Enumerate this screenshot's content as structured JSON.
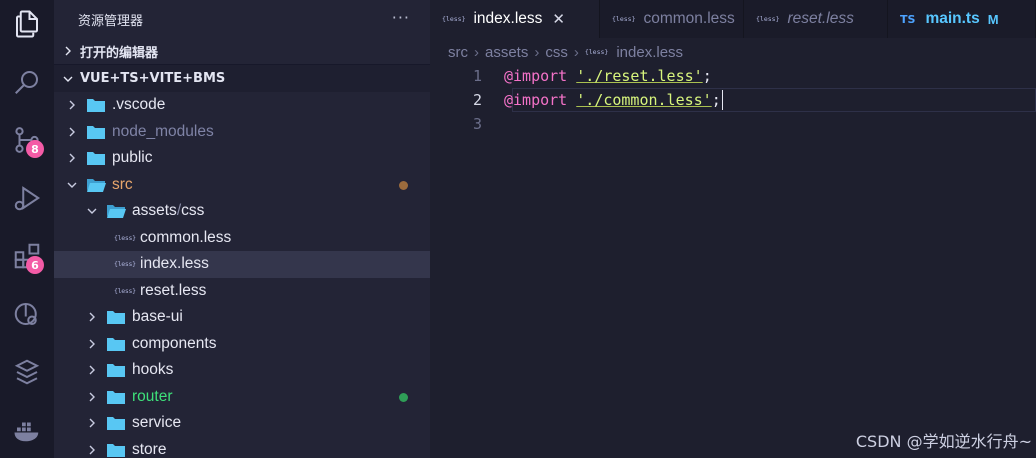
{
  "sidebar": {
    "title": "资源管理器",
    "more": "···",
    "open_editors": "打开的编辑器",
    "project": "VUE+TS+VITE+BMS",
    "tree": [
      {
        "label": ".vscode",
        "type": "folder",
        "depth": 1,
        "expanded": false,
        "color": "#e6e7f2"
      },
      {
        "label": "node_modules",
        "type": "folder",
        "depth": 1,
        "expanded": false,
        "color": "#7f83a6"
      },
      {
        "label": "public",
        "type": "folder",
        "depth": 1,
        "expanded": false,
        "color": "#e6e7f2"
      },
      {
        "label": "src",
        "type": "folder",
        "depth": 1,
        "expanded": true,
        "color": "#e8a66b",
        "dot": "#9b6b3d"
      },
      {
        "label": "assets",
        "label2": "css",
        "type": "folder",
        "depth": 2,
        "expanded": true,
        "color": "#e6e7f2"
      },
      {
        "label": "common.less",
        "type": "less",
        "depth": 3,
        "color": "#e6e7f2"
      },
      {
        "label": "index.less",
        "type": "less",
        "depth": 3,
        "color": "#e6e7f2",
        "selected": true
      },
      {
        "label": "reset.less",
        "type": "less",
        "depth": 3,
        "color": "#e6e7f2"
      },
      {
        "label": "base-ui",
        "type": "folder",
        "depth": 2,
        "expanded": false,
        "color": "#e6e7f2"
      },
      {
        "label": "components",
        "type": "folder",
        "depth": 2,
        "expanded": false,
        "color": "#e6e7f2"
      },
      {
        "label": "hooks",
        "type": "folder",
        "depth": 2,
        "expanded": false,
        "color": "#e6e7f2"
      },
      {
        "label": "router",
        "type": "folder",
        "depth": 2,
        "expanded": false,
        "color": "#3ee07a",
        "dot": "#2f9e57"
      },
      {
        "label": "service",
        "type": "folder",
        "depth": 2,
        "expanded": false,
        "color": "#e6e7f2"
      },
      {
        "label": "store",
        "type": "folder",
        "depth": 2,
        "expanded": false,
        "color": "#e6e7f2"
      }
    ]
  },
  "activity": {
    "scm_badge": "8",
    "extensions_badge": "6"
  },
  "tabs": [
    {
      "label": "index.less",
      "icon": "{less}",
      "active": true
    },
    {
      "label": "common.less",
      "icon": "{less}"
    },
    {
      "label": "reset.less",
      "icon": "{less}",
      "italic": true
    },
    {
      "label": "main.ts",
      "icon": "TS",
      "modified": "M"
    }
  ],
  "breadcrumb": {
    "parts": [
      "src",
      "assets",
      "css"
    ],
    "file": "index.less",
    "file_icon": "{less}"
  },
  "code": {
    "lines": [
      {
        "num": "1",
        "kw": "@import",
        "str": "'./reset.less'",
        "end": ";"
      },
      {
        "num": "2",
        "kw": "@import",
        "str": "'./common.less'",
        "end": ";"
      },
      {
        "num": "3"
      }
    ]
  },
  "watermark": "CSDN @学如逆水行舟~",
  "colors": {
    "activity_bg": "#191a29",
    "sidebar_bg": "#232436",
    "editor_bg": "#1e1f2e",
    "badge": "#f45ba6",
    "folder": "#58c7f3"
  }
}
